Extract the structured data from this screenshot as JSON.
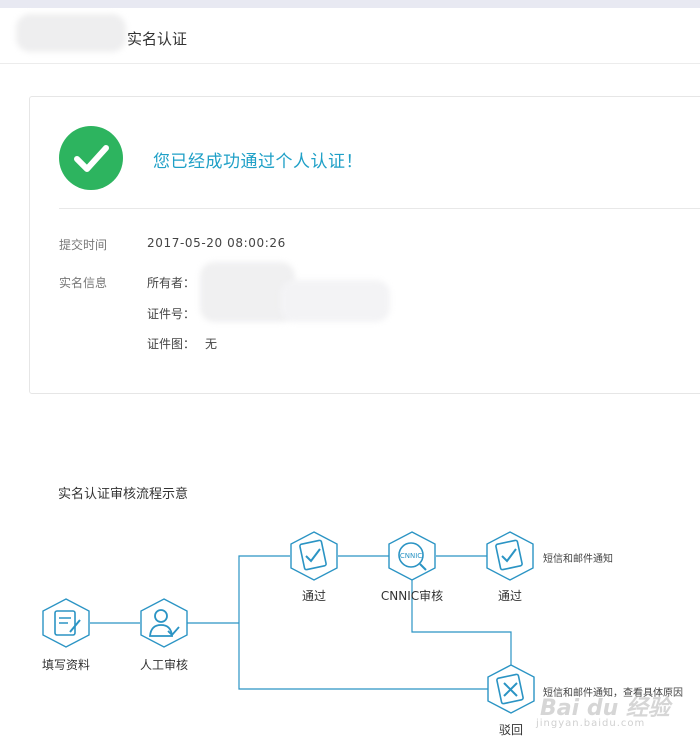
{
  "header": {
    "title": "实名认证"
  },
  "result": {
    "message": "您已经成功通过个人认证！",
    "submit_time_label": "提交时间",
    "submit_time_value": "2017-05-20 08:00:26",
    "info_label": "实名信息",
    "owner_label": "所有者：",
    "id_label": "证件号：",
    "id_image_label": "证件图：",
    "id_image_value": "无"
  },
  "flow": {
    "title": "实名认证审核流程示意",
    "nodes": {
      "fill": "填写资料",
      "manual_review": "人工审核",
      "pass1": "通过",
      "cnnic_review": "CNNIC审核",
      "pass2": "通过",
      "reject": "驳回"
    },
    "notes": {
      "notify_pass": "短信和邮件通知",
      "notify_reject": "短信和邮件通知，查看具体原因"
    },
    "cnnic_icon_text": "CNNIC"
  },
  "watermark": {
    "main": "Bai du 经验",
    "sub": "jingyan.baidu.com"
  },
  "colors": {
    "success_green": "#2db45f",
    "accent_blue": "#1fa0c7",
    "line_blue": "#2b94c4"
  }
}
